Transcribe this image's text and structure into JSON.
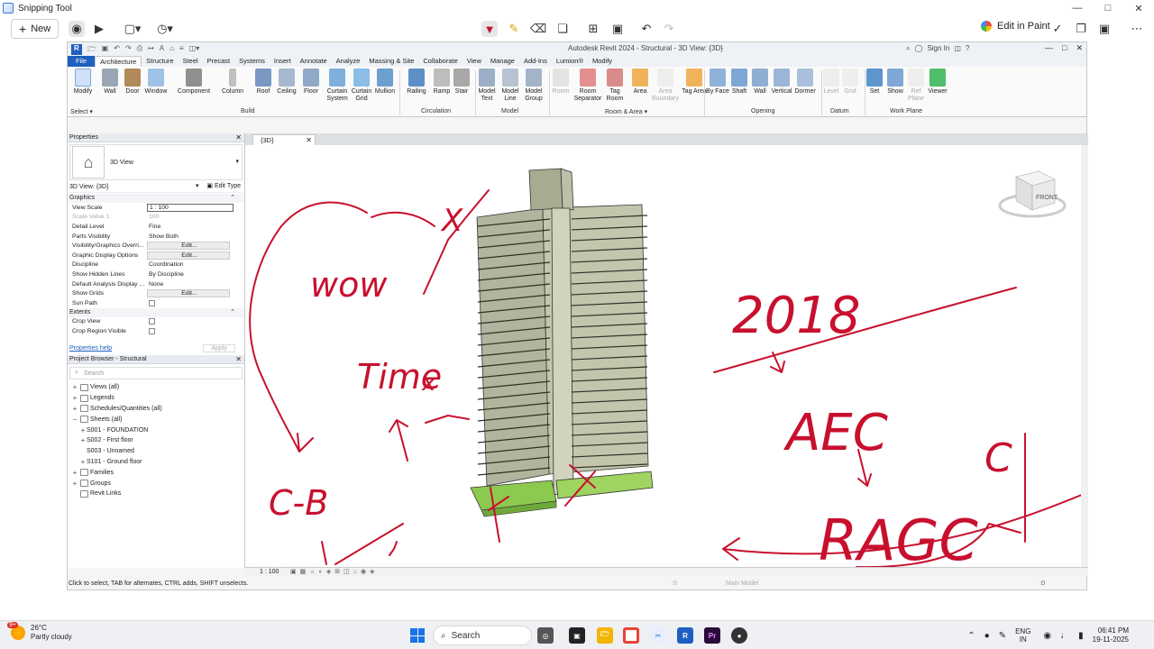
{
  "snip": {
    "title": "Snipping Tool",
    "new_label": "New",
    "edit_in_paint": "Edit in Paint"
  },
  "revit": {
    "title": "Autodesk Revit 2024 - Structural - 3D View: {3D}",
    "sign_in": "Sign In",
    "tabs": [
      "File",
      "Architecture",
      "Structure",
      "Steel",
      "Precast",
      "Systems",
      "Insert",
      "Annotate",
      "Analyze",
      "Massing & Site",
      "Collaborate",
      "View",
      "Manage",
      "Add-Ins",
      "Lumion®",
      "Modify"
    ],
    "ribbon": {
      "modify": "Modify",
      "wall": "Wall",
      "door": "Door",
      "window": "Window",
      "component": "Component",
      "column": "Column",
      "roof": "Roof",
      "ceiling": "Ceiling",
      "floor": "Floor",
      "curtain_system": "Curtain System",
      "curtain_grid": "Curtain Grid",
      "mullion": "Mullion",
      "railing": "Railing",
      "ramp": "Ramp",
      "stair": "Stair",
      "model_text": "Model Text",
      "model_line": "Model Line",
      "model_group": "Model Group",
      "room": "Room",
      "room_separator": "Room Separator",
      "tag_room": "Tag Room",
      "area": "Area",
      "area_boundary": "Area Boundary",
      "tag_area": "Tag Area",
      "by_face": "By Face",
      "shaft": "Shaft",
      "wall_op": "Wall",
      "vertical": "Vertical",
      "dormer": "Dormer",
      "level": "Level",
      "grid": "Grid",
      "set": "Set",
      "show": "Show",
      "ref_plane": "Ref Plane",
      "viewer": "Viewer",
      "panels": {
        "select": "Select ▾",
        "build": "Build",
        "circulation": "Circulation",
        "model": "Model",
        "room_area": "Room & Area ▾",
        "opening": "Opening",
        "datum": "Datum",
        "work_plane": "Work Plane"
      }
    },
    "properties": {
      "header": "Properties",
      "type_name": "3D View",
      "view_selector": "3D View: {3D}",
      "edit_type": "Edit Type",
      "cat_graphics": "Graphics",
      "rows": [
        {
          "k": "View Scale",
          "v": "1 : 100",
          "style": "boxed"
        },
        {
          "k": "Scale Value    1:",
          "v": "100",
          "style": "dim"
        },
        {
          "k": "Detail Level",
          "v": "Fine",
          "style": ""
        },
        {
          "k": "Parts Visibility",
          "v": "Show Both",
          "style": ""
        },
        {
          "k": "Visibility/Graphics Overri...",
          "v": "Edit...",
          "style": "btn"
        },
        {
          "k": "Graphic Display Options",
          "v": "Edit...",
          "style": "btn"
        },
        {
          "k": "Discipline",
          "v": "Coordination",
          "style": ""
        },
        {
          "k": "Show Hidden Lines",
          "v": "By Discipline",
          "style": ""
        },
        {
          "k": "Default Analysis Display ...",
          "v": "None",
          "style": ""
        },
        {
          "k": "Show Grids",
          "v": "Edit...",
          "style": "btn"
        },
        {
          "k": "Sun Path",
          "v": "",
          "style": "check"
        }
      ],
      "cat_extents": "Extents",
      "rows2": [
        {
          "k": "Crop View",
          "v": "",
          "style": "check"
        },
        {
          "k": "Crop Region Visible",
          "v": "",
          "style": "check"
        }
      ],
      "help": "Properties help",
      "apply": "Apply"
    },
    "browser": {
      "header": "Project Browser - Structural",
      "search_placeholder": "Search",
      "items": [
        {
          "exp": "+",
          "label": "Views (all)",
          "indent": 0
        },
        {
          "exp": "+",
          "label": "Legends",
          "indent": 0
        },
        {
          "exp": "+",
          "label": "Schedules/Quantities (all)",
          "indent": 0
        },
        {
          "exp": "−",
          "label": "Sheets (all)",
          "indent": 0
        },
        {
          "exp": "+",
          "label": "S001 - FOUNDATION",
          "indent": 1
        },
        {
          "exp": "+",
          "label": "S002 - First floor",
          "indent": 1
        },
        {
          "exp": "",
          "label": "S003 - Unnamed",
          "indent": 1
        },
        {
          "exp": "+",
          "label": "S101 - Ground floor",
          "indent": 1
        },
        {
          "exp": "+",
          "label": "Families",
          "indent": 0
        },
        {
          "exp": "+",
          "label": "Groups",
          "indent": 0
        },
        {
          "exp": "",
          "label": "Revit Links",
          "indent": 0
        }
      ]
    },
    "view_tab": "{3D}",
    "view_scale": "1 : 100",
    "status": "Click to select, TAB for alternates, CTRL adds, SHIFT unselects.",
    "status_zero": ":0",
    "main_model": "Main Model",
    "status_zero2": ":0",
    "viewcube_label": "FRONT"
  },
  "annotations": {
    "wow": "wow",
    "x1": "X",
    "time": "Time",
    "x2": "x",
    "cb": "C-B",
    "year": "2018",
    "aec": "AEC",
    "c": "C",
    "ragc": "RAGC"
  },
  "taskbar": {
    "temp": "26°C",
    "weather": "Partly cloudy",
    "badge": "9+",
    "search": "Search",
    "lang1": "ENG",
    "lang2": "IN",
    "time": "06:41 PM",
    "date": "19-11-2025"
  },
  "colors": {
    "ink": "#c8102e",
    "revit_blue": "#1f5fbf",
    "building": "#b7b9a4",
    "foundation": "#a9d46a"
  }
}
